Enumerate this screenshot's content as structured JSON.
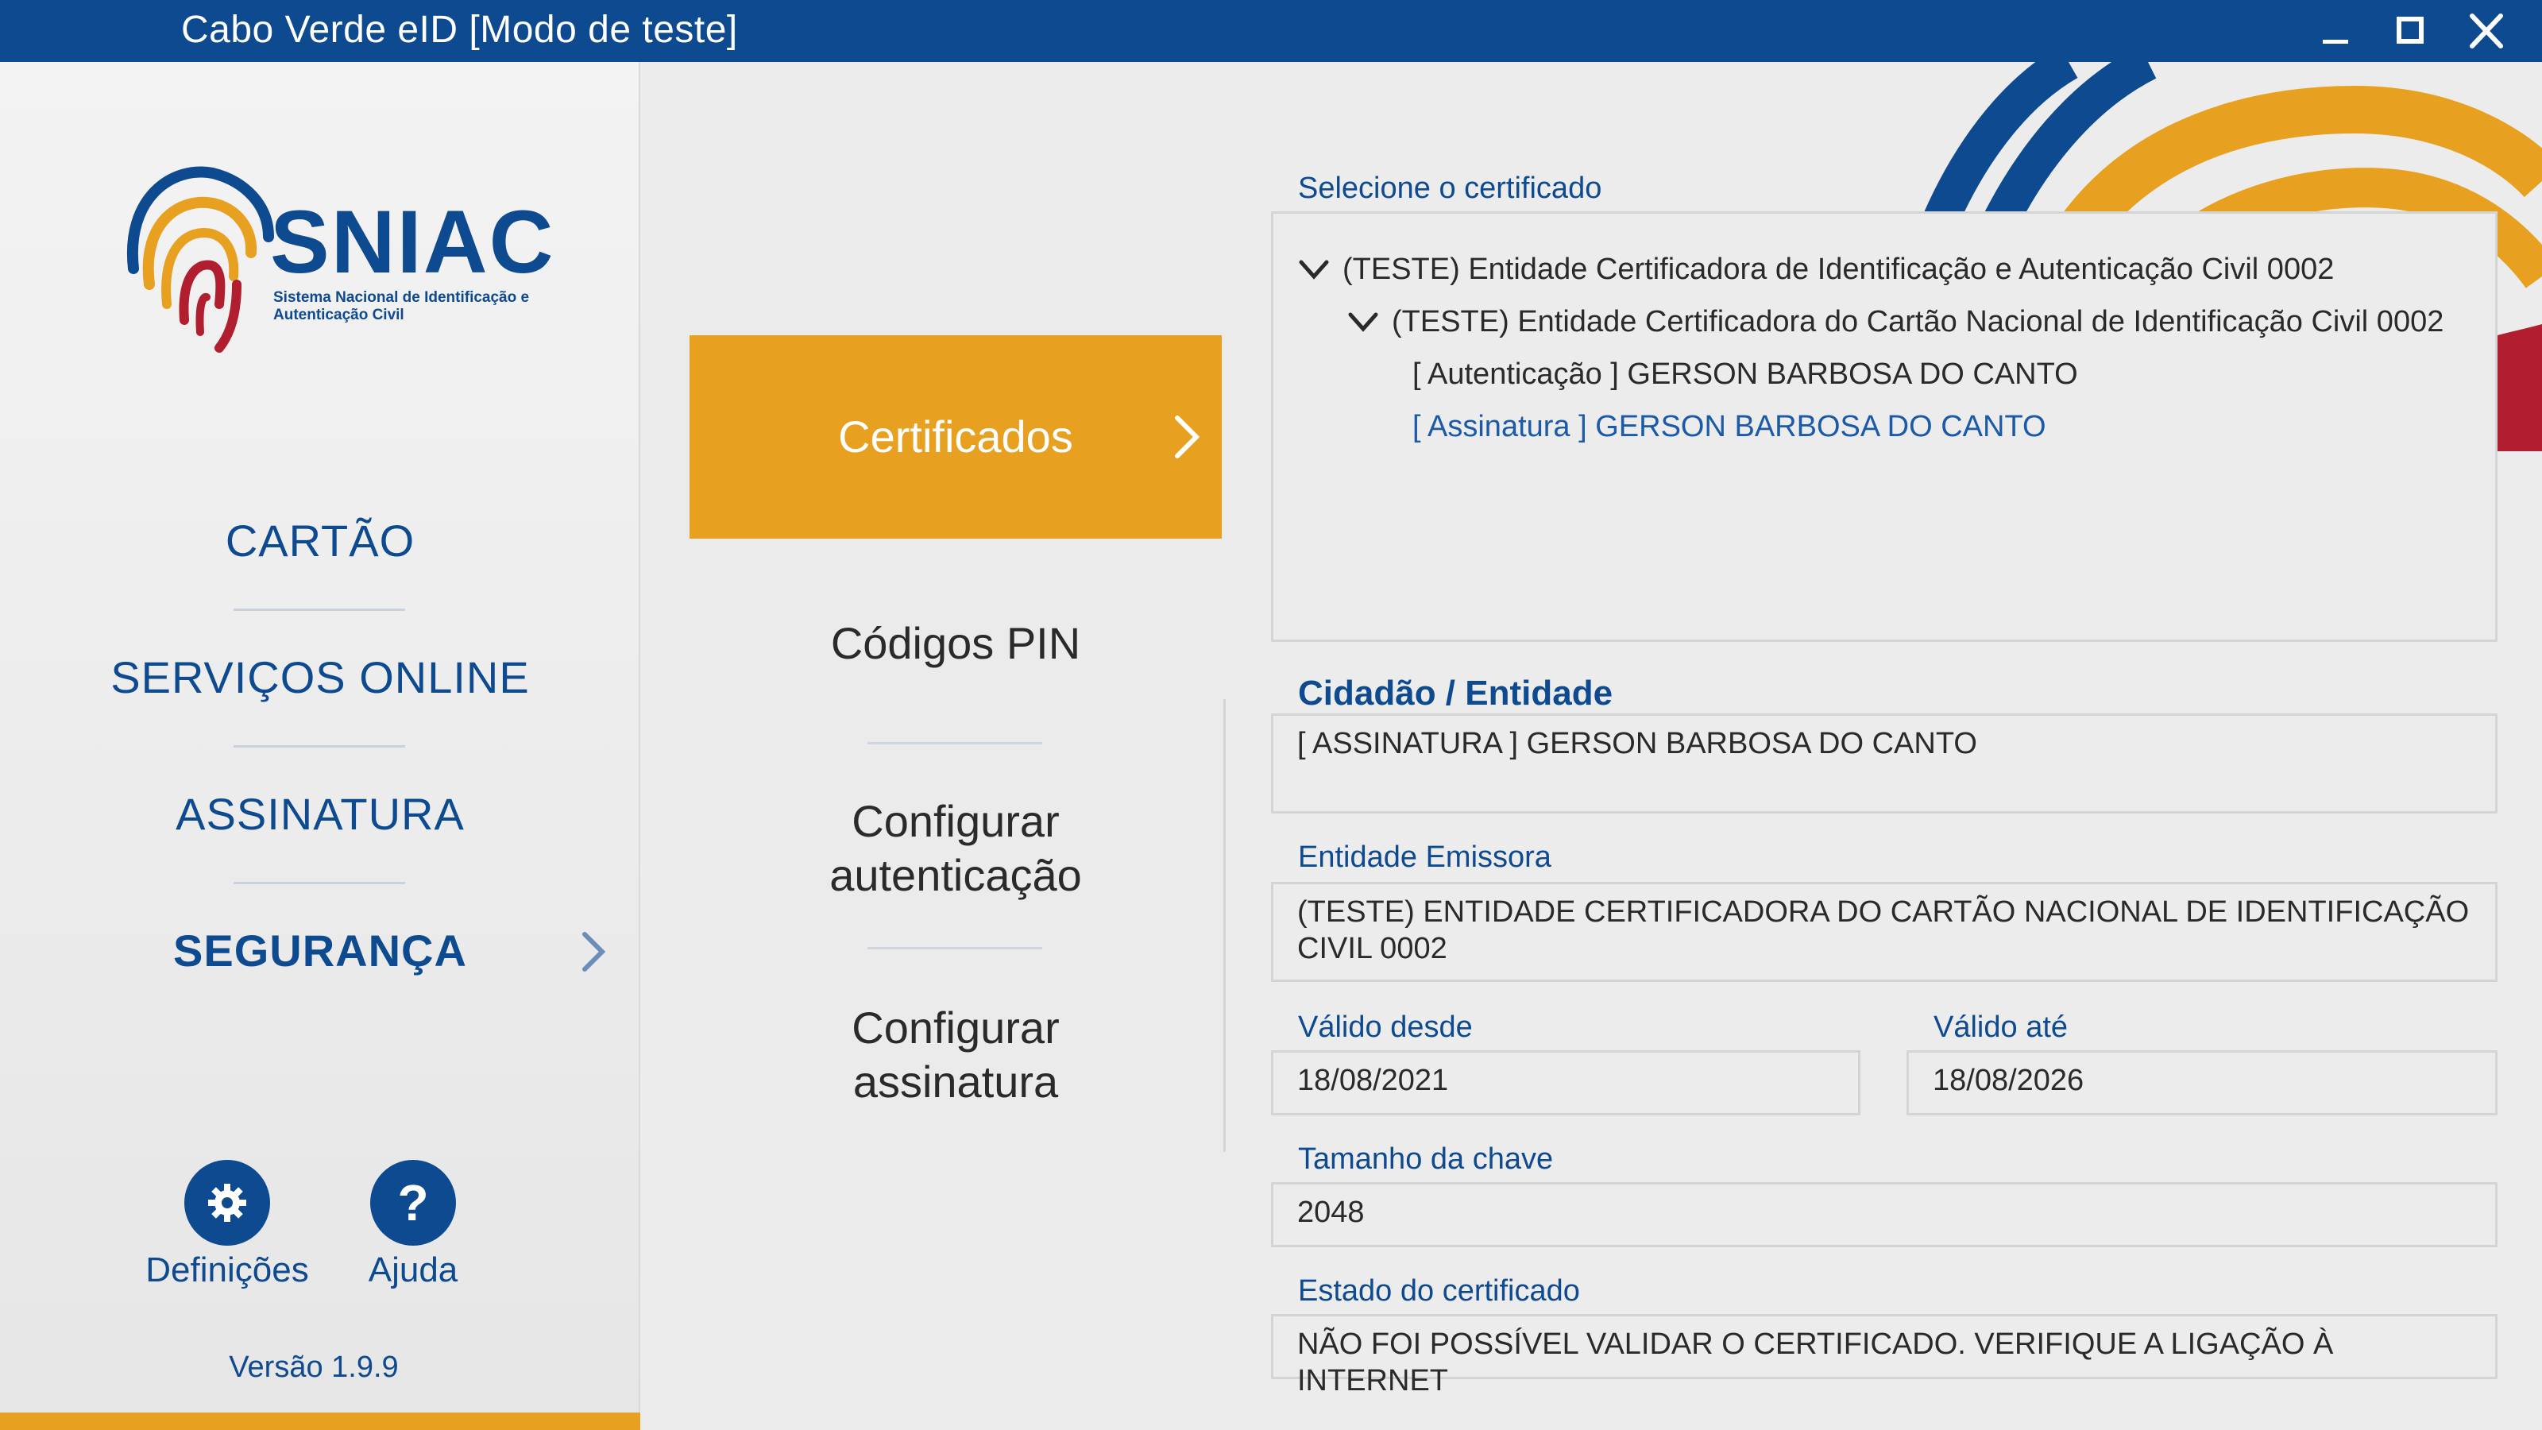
{
  "window": {
    "title": "Cabo Verde eID  [Modo de teste]",
    "minimize_icon": "minimize-icon",
    "maximize_icon": "maximize-icon",
    "close_icon": "close-icon"
  },
  "sidebar": {
    "logo": {
      "brand": "SNIAC",
      "subtitle": "Sistema Nacional de Identificação e Autenticação Civil"
    },
    "items": [
      {
        "label": "CARTÃO"
      },
      {
        "label": "SERVIÇOS ONLINE"
      },
      {
        "label": "ASSINATURA"
      },
      {
        "label": "SEGURANÇA",
        "active": true
      }
    ],
    "settings_label": "Definições",
    "help_label": "Ajuda",
    "help_glyph": "?",
    "version": "Versão 1.9.9"
  },
  "submenu": {
    "items": [
      {
        "label": "Certificados",
        "active": true
      },
      {
        "label": "Códigos PIN"
      },
      {
        "label_line1": "Configurar",
        "label_line2": "autenticação"
      },
      {
        "label_line1": "Configurar",
        "label_line2": "assinatura"
      }
    ]
  },
  "certificates": {
    "select_label": "Selecione o certificado",
    "tree": [
      {
        "text": "(TESTE) Entidade Certificadora de Identificação e Autenticação Civil 0002",
        "level": 0,
        "expanded": true
      },
      {
        "text": "(TESTE) Entidade Certificadora do Cartão Nacional de Identificação Civil 0002",
        "level": 1,
        "expanded": true
      },
      {
        "text": "[ Autenticação ] GERSON BARBOSA DO CANTO",
        "level": 2
      },
      {
        "text": "[ Assinatura ] GERSON BARBOSA DO CANTO",
        "level": 2,
        "selected": true
      }
    ],
    "citizen_label": "Cidadão / Entidade",
    "citizen_value": "[ ASSINATURA ] GERSON BARBOSA DO CANTO",
    "issuer_label": "Entidade Emissora",
    "issuer_value": "(TESTE) ENTIDADE CERTIFICADORA DO CARTÃO NACIONAL DE IDENTIFICAÇÃO CIVIL 0002",
    "valid_from_label": "Válido desde",
    "valid_from_value": "18/08/2021",
    "valid_to_label": "Válido até",
    "valid_to_value": "18/08/2026",
    "key_size_label": "Tamanho da chave",
    "key_size_value": "2048",
    "status_label": "Estado do certificado",
    "status_value": "NÃO FOI POSSÍVEL VALIDAR O CERTIFICADO. VERIFIQUE A LIGAÇÃO À INTERNET"
  },
  "colors": {
    "primary": "#0e4a8f",
    "accent": "#e8a020",
    "decor_red": "#b01e2f"
  }
}
